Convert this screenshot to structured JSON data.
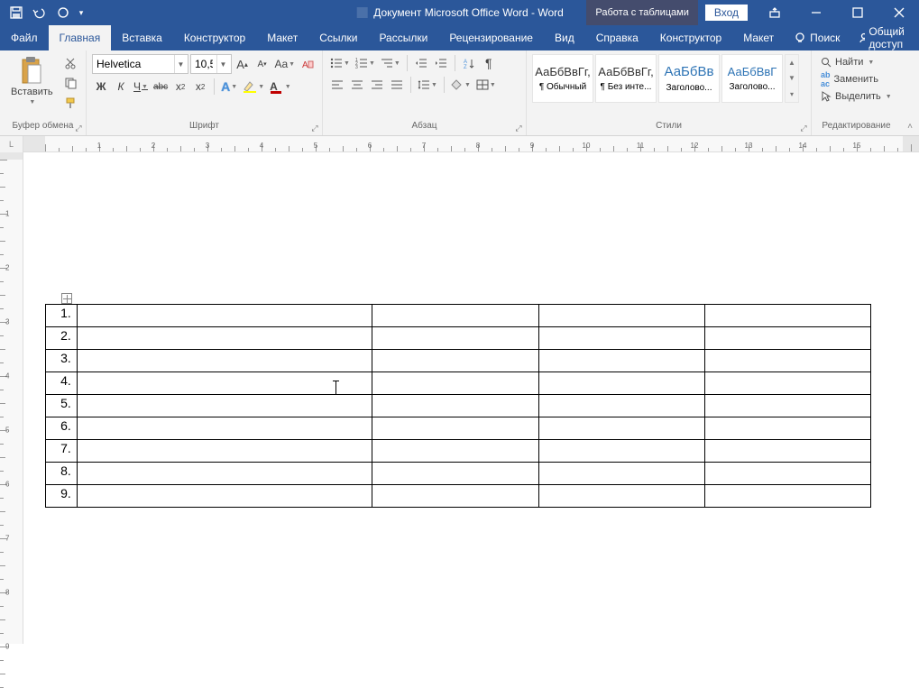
{
  "titlebar": {
    "doc_title": "Документ Microsoft Office Word  -  Word",
    "table_tools": "Работа с таблицами",
    "login": "Вход"
  },
  "tabs": {
    "file": "Файл",
    "home": "Главная",
    "insert": "Вставка",
    "design": "Конструктор",
    "layout": "Макет",
    "references": "Ссылки",
    "mailings": "Рассылки",
    "review": "Рецензирование",
    "view": "Вид",
    "help": "Справка",
    "ctx_design": "Конструктор",
    "ctx_layout": "Макет",
    "tellme": "Поиск",
    "share": "Общий доступ"
  },
  "ribbon": {
    "clipboard": {
      "paste": "Вставить",
      "label": "Буфер обмена"
    },
    "font": {
      "name": "Helvetica",
      "size": "10,5",
      "bold": "Ж",
      "italic": "К",
      "underline": "Ч",
      "strike": "abc",
      "label": "Шрифт"
    },
    "paragraph": {
      "label": "Абзац"
    },
    "styles": {
      "s1_prev": "АаБбВвГг,",
      "s1_name": "¶ Обычный",
      "s2_prev": "АаБбВвГг,",
      "s2_name": "¶ Без инте...",
      "s3_prev": "АаБбВв",
      "s3_name": "Заголово...",
      "s4_prev": "АаБбВвГ",
      "s4_name": "Заголово...",
      "label": "Стили"
    },
    "editing": {
      "find": "Найти",
      "replace": "Заменить",
      "select": "Выделить",
      "label": "Редактирование"
    }
  },
  "document": {
    "rows": [
      "1.",
      "2.",
      "3.",
      "4.",
      "5.",
      "6.",
      "7.",
      "8.",
      "9."
    ]
  },
  "ruler": {
    "h_numbers": [
      "1",
      "2",
      "1",
      "2",
      "3",
      "4",
      "5",
      "6",
      "7",
      "8",
      "9",
      "10",
      "11",
      "12",
      "13",
      "14",
      "15"
    ]
  }
}
